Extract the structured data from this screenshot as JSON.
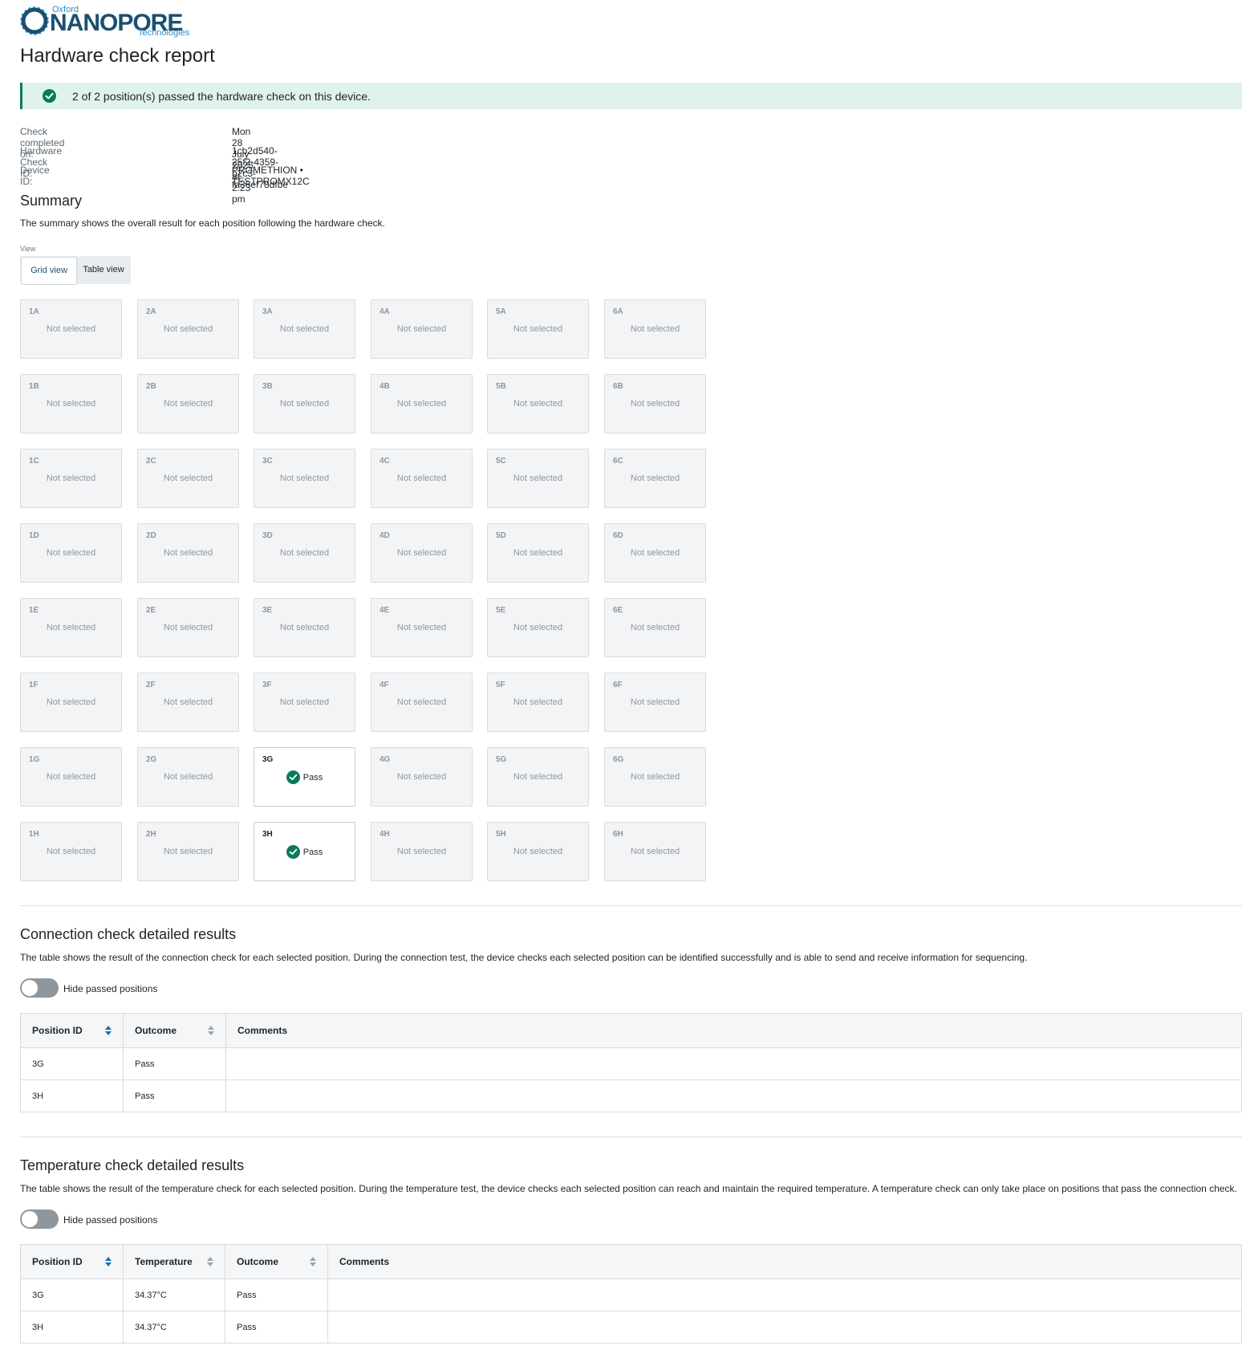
{
  "brand": {
    "top": "Oxford",
    "name": "NANOPORE",
    "sub": "Technologies"
  },
  "title": "Hardware check report",
  "banner": "2 of 2 position(s) passed the hardware check on this device.",
  "meta": [
    {
      "label": "Check completed on:",
      "value": "Mon 28 July 2025 at 2:23 pm"
    },
    {
      "label": "Hardware Check ID:",
      "value": "1cb2d540-25f2-4359-b2c3-fa36ef78dfbe"
    },
    {
      "label": "Device ID:",
      "value": "PROMETHION • TESTPROMX12C"
    }
  ],
  "summary": {
    "heading": "Summary",
    "description": "The summary shows the overall result for each position following the hardware check.",
    "view_label": "View",
    "grid_view": "Grid view",
    "table_view": "Table view",
    "columns": [
      "1",
      "2",
      "3",
      "4",
      "5",
      "6"
    ],
    "rows": [
      "A",
      "B",
      "C",
      "D",
      "E",
      "F",
      "G",
      "H"
    ],
    "not_selected": "Not selected",
    "pass_label": "Pass",
    "passed_positions": [
      "3G",
      "3H"
    ]
  },
  "connection": {
    "heading": "Connection check detailed results",
    "description": "The table shows the result of the connection check for each selected position. During the connection test, the device checks each selected position can be identified successfully and is able to send and receive information for sequencing.",
    "toggle_label": "Hide passed positions",
    "headers": [
      "Position ID",
      "Outcome",
      "Comments"
    ],
    "rows": [
      {
        "position": "3G",
        "outcome": "Pass",
        "comments": ""
      },
      {
        "position": "3H",
        "outcome": "Pass",
        "comments": ""
      }
    ]
  },
  "temperature": {
    "heading": "Temperature check detailed results",
    "description": "The table shows the result of the temperature check for each selected position. During the temperature test, the device checks each selected position can reach and maintain the required temperature. A temperature check can only take place on positions that pass the connection check.",
    "toggle_label": "Hide passed positions",
    "headers": [
      "Position ID",
      "Temperature",
      "Outcome",
      "Comments"
    ],
    "rows": [
      {
        "position": "3G",
        "temperature": "34.37°C",
        "outcome": "Pass",
        "comments": ""
      },
      {
        "position": "3H",
        "temperature": "34.37°C",
        "outcome": "Pass",
        "comments": ""
      }
    ]
  },
  "colors": {
    "pass_green": "#0a7a5a",
    "banner_bg": "#dff3ec",
    "brand_blue": "#1b4f6f"
  }
}
